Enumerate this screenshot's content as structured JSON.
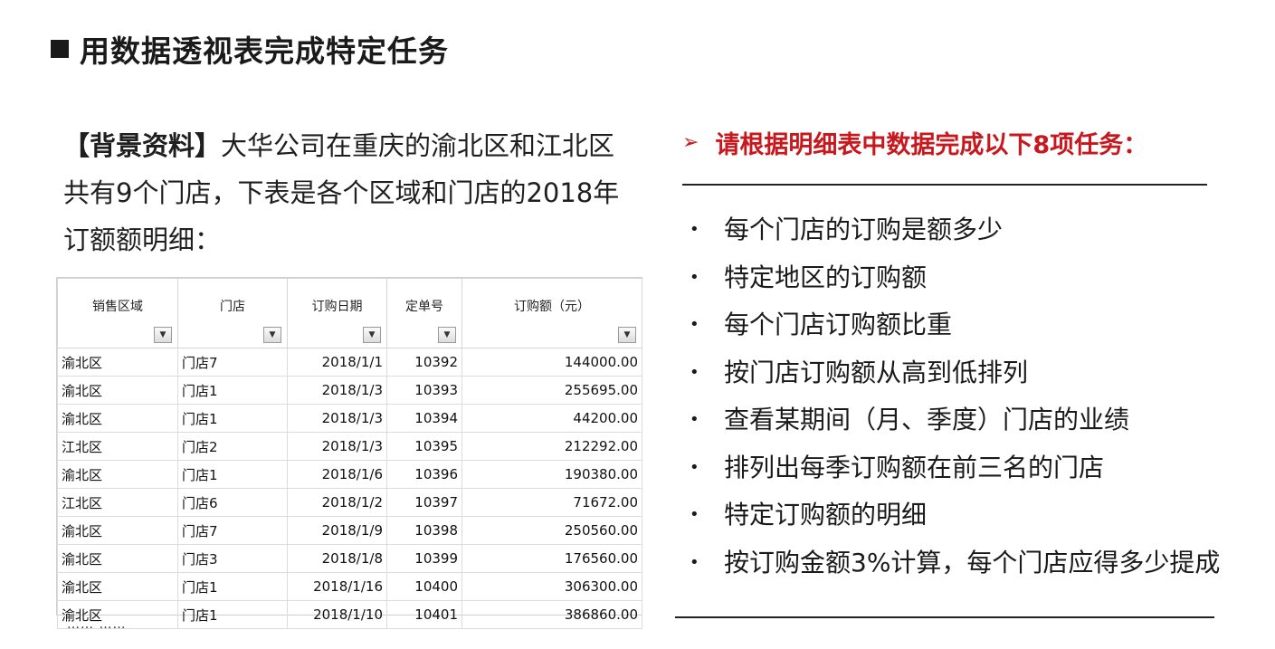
{
  "title": "用数据透视表完成特定任务",
  "background": {
    "label": "【背景资料】",
    "lines": [
      "大华公司在重庆的渝北区和江北区",
      "共有9个门店，下表是各个区域和门店的2018年",
      "订额额明细："
    ]
  },
  "table": {
    "headers": [
      "销售区域",
      "门店",
      "订购日期",
      "定单号",
      "订购额（元）"
    ],
    "rows": [
      [
        "渝北区",
        "门店7",
        "2018/1/1",
        "10392",
        "144000.00"
      ],
      [
        "渝北区",
        "门店1",
        "2018/1/3",
        "10393",
        "255695.00"
      ],
      [
        "渝北区",
        "门店1",
        "2018/1/3",
        "10394",
        "44200.00"
      ],
      [
        "江北区",
        "门店2",
        "2018/1/3",
        "10395",
        "212292.00"
      ],
      [
        "渝北区",
        "门店1",
        "2018/1/6",
        "10396",
        "190380.00"
      ],
      [
        "江北区",
        "门店6",
        "2018/1/2",
        "10397",
        "71672.00"
      ],
      [
        "渝北区",
        "门店7",
        "2018/1/9",
        "10398",
        "250560.00"
      ],
      [
        "渝北区",
        "门店3",
        "2018/1/8",
        "10399",
        "176560.00"
      ],
      [
        "渝北区",
        "门店1",
        "2018/1/16",
        "10400",
        "306300.00"
      ],
      [
        "渝北区",
        "门店1",
        "2018/1/10",
        "10401",
        "386860.00"
      ]
    ],
    "ellipsis": "…… ……"
  },
  "tasks_heading": "请根据明细表中数据完成以下8项任务：",
  "tasks": [
    "每个门店的订购是额多少",
    "特定地区的订购额",
    "每个门店订购额比重",
    "按门店订购额从高到低排列",
    "查看某期间（月、季度）门店的业绩",
    "排列出每季订购额在前三名的门店",
    "特定订购额的明细",
    "按订购金额3%计算，每个门店应得多少提成"
  ],
  "colors": {
    "accent_red": "#c8181e"
  }
}
